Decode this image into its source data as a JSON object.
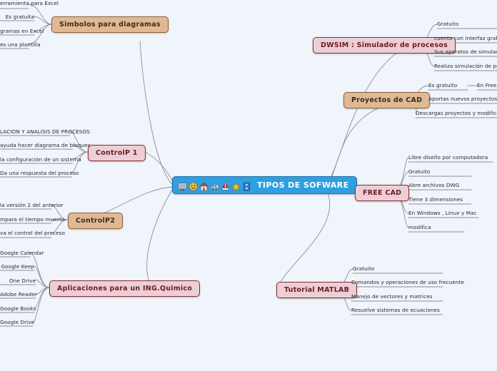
{
  "diagram": {
    "type": "mind-map",
    "background_color": "#f0f4fb",
    "edge_color": "#8a8f99"
  },
  "central": {
    "title": "TIPOS DE SOFWARE",
    "fill_color": "#2e9fe0",
    "border_color": "#1d6fa5",
    "text_color": "#ffffff",
    "icons": [
      "monitor-icon",
      "smiley-icon",
      "house-icon",
      "train-icon",
      "sailboat-icon",
      "star-icon",
      "updown-arrow-icon"
    ]
  },
  "branches": [
    {
      "id": "simbolos",
      "label": "Simbolos para diagramas",
      "style": "tan",
      "side": "left",
      "children": [
        "erramienta para Excel",
        "Es gratuita",
        "gramas en Excel",
        "es una plantilla"
      ]
    },
    {
      "id": "dwsim",
      "label": "DWSIM : Simulador de procesos",
      "style": "pink",
      "side": "right",
      "children": [
        "Gratuito",
        "cuenta con interfaz grafica intu",
        "Sus aparatos de simulación sor",
        "Realiza simulación de procesos"
      ]
    },
    {
      "id": "proyectos-cad",
      "label": "Proyectos de CAD",
      "style": "tan",
      "side": "right",
      "children": [
        "Es gratuito",
        "Aportas nuevos proyectos",
        "Descargas proyectos y modificas"
      ],
      "subchildren": [
        {
          "parent": "Es gratuito",
          "label": "En  Free CAD s"
        }
      ]
    },
    {
      "id": "free-cad",
      "label": "FREE CAD",
      "style": "pink",
      "side": "right",
      "children": [
        "Libre diseño por computadora",
        "Gratuito",
        "Abre archivos DWG",
        "Tiene 3 dimensiones",
        "En Windows , Linux y Mac",
        "modifica"
      ]
    },
    {
      "id": "matlab",
      "label": "Tutorial MATLAB",
      "style": "pink",
      "side": "right",
      "children": [
        "Gratuito",
        "Comandos y operaciones de uso frecuente",
        "Manejo de vectores y matrices",
        "Resuelve sistemas de ecuaciones"
      ]
    },
    {
      "id": "aplicaciones",
      "label": "Aplicaciones para un ING.Quimico",
      "style": "pink",
      "side": "left",
      "children": [
        "Google Calendar",
        "Google Keep",
        "One Drive",
        "Adobe Reader",
        "Google Books",
        "Google Drive"
      ]
    },
    {
      "id": "controlp2",
      "label": "ControlP2",
      "style": "tan",
      "side": "left",
      "children": [
        "la versión 2 del anterior",
        "mpara el tiempo muerto",
        "va el control del proceso"
      ]
    },
    {
      "id": "controlp1",
      "label": "ControlP 1",
      "style": "pink",
      "side": "left",
      "children": [
        "LACION Y ANALISIS DE PROCESOS",
        "ayuda hacer diagrama de bloques",
        "la configuración de un sistema",
        "Da una respuesta del proceso"
      ]
    }
  ]
}
